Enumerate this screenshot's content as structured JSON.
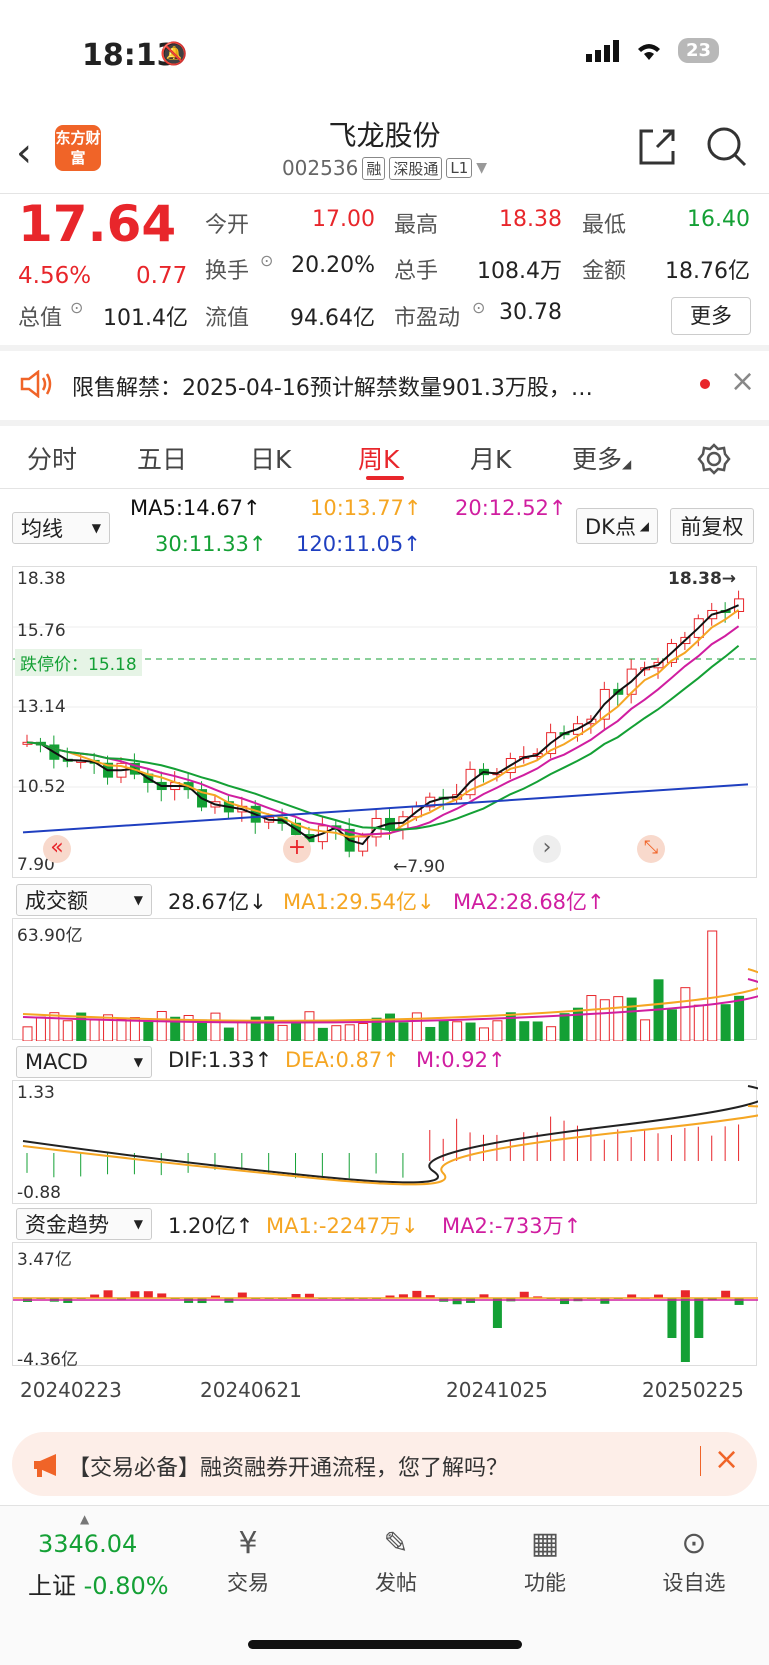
{
  "status_bar": {
    "time": "18:13",
    "battery": "23"
  },
  "header": {
    "logo_text": "东方财富",
    "stock_name": "飞龙股份",
    "stock_code": "002536",
    "tags": [
      "融",
      "深股通",
      "L1"
    ]
  },
  "quote": {
    "price": "17.64",
    "change_pct": "4.56%",
    "change": "0.77",
    "fields": [
      {
        "label": "今开",
        "value": "17.00",
        "color": "red"
      },
      {
        "label": "最高",
        "value": "18.38",
        "color": "red"
      },
      {
        "label": "最低",
        "value": "16.40",
        "color": "green"
      },
      {
        "label": "换手",
        "value": "20.20%",
        "color": "black"
      },
      {
        "label": "总手",
        "value": "108.4万",
        "color": "black"
      },
      {
        "label": "金额",
        "value": "18.76亿",
        "color": "black"
      },
      {
        "label": "总值",
        "value": "101.4亿",
        "color": "black"
      },
      {
        "label": "流值",
        "value": "94.64亿",
        "color": "black"
      },
      {
        "label": "市盈动",
        "value": "30.78",
        "color": "black"
      }
    ],
    "more_label": "更多"
  },
  "notice": {
    "text": "限售解禁：2025-04-16预计解禁数量901.3万股，…"
  },
  "tabs": [
    "分时",
    "五日",
    "日K",
    "周K",
    "月K",
    "更多"
  ],
  "active_tab": "周K",
  "ma_panel": {
    "selector": "均线",
    "ma5": "MA5:14.67↑",
    "ma10": "10:13.77↑",
    "ma20": "20:12.52↑",
    "ma30": "30:11.33↑",
    "ma120": "120:11.05↑",
    "dk_label": "DK点",
    "adjust_label": "前复权"
  },
  "kline": {
    "y_top": "18.38",
    "y_mid1": "15.76",
    "y_mid2": "13.14",
    "y_mid3": "10.52",
    "y_bottom": "7.90",
    "max_label": "18.38→",
    "min_label": "←7.90",
    "limit_down_label": "跌停价：15.18"
  },
  "volume_panel": {
    "selector": "成交额",
    "value": "28.67亿↓",
    "ma1": "MA1:29.54亿↓",
    "ma2": "MA2:28.68亿↑",
    "y_top": "63.90亿"
  },
  "macd_panel": {
    "selector": "MACD",
    "dif": "DIF:1.33↑",
    "dea": "DEA:0.87↑",
    "m": "M:0.92↑",
    "y_top": "1.33",
    "y_bottom": "-0.88"
  },
  "fund_panel": {
    "selector": "资金趋势",
    "value": "1.20亿↑",
    "ma1": "MA1:-2247万↓",
    "ma2": "MA2:-733万↑",
    "y_top": "3.47亿",
    "y_bottom": "-4.36亿"
  },
  "dates": [
    "20240223",
    "20240621",
    "20241025",
    "20250225"
  ],
  "ad": {
    "text": "【交易必备】融资融券开通流程，您了解吗？"
  },
  "bottom_nav": {
    "index_value": "3346.04",
    "index_label": "上证",
    "index_change": "-0.80%",
    "items": [
      "交易",
      "发帖",
      "功能",
      "设自选"
    ]
  },
  "colors": {
    "up": "#e8262b",
    "down": "#14a035",
    "accent": "#e8262b",
    "ma5": "#111111",
    "ma10": "#f5a623",
    "ma20": "#d01ea0",
    "ma30": "#14a035",
    "ma120": "#1f3fc0"
  }
}
